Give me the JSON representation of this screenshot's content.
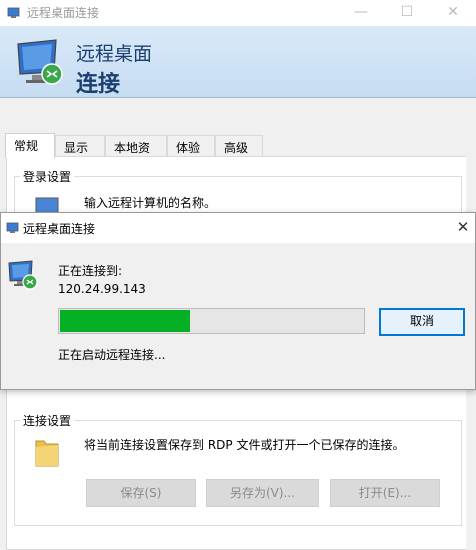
{
  "main_window": {
    "title": "远程桌面连接",
    "controls": {
      "minimize": "—",
      "maximize": "☐",
      "close": "✕"
    },
    "banner": {
      "line1": "远程桌面",
      "line2": "连接"
    },
    "tabs": [
      {
        "label": "常规",
        "active": true
      },
      {
        "label": "显示"
      },
      {
        "label": "本地资源"
      },
      {
        "label": "体验"
      },
      {
        "label": "高级"
      }
    ],
    "login_settings": {
      "label": "登录设置",
      "hint": "输入远程计算机的名称。"
    },
    "connection_settings": {
      "label": "连接设置",
      "description": "将当前连接设置保存到 RDP 文件或打开一个已保存的连接。",
      "save_label": "保存(S)",
      "save_as_label": "另存为(V)...",
      "open_label": "打开(E)..."
    }
  },
  "progress_dialog": {
    "title": "远程桌面连接",
    "close": "✕",
    "connecting_label": "正在连接到:",
    "host": "120.24.99.143",
    "progress_fraction": 0.43,
    "cancel_label": "取消",
    "status": "正在启动远程连接...",
    "colors": {
      "progress": "#06b025",
      "accent": "#0078d7"
    }
  }
}
